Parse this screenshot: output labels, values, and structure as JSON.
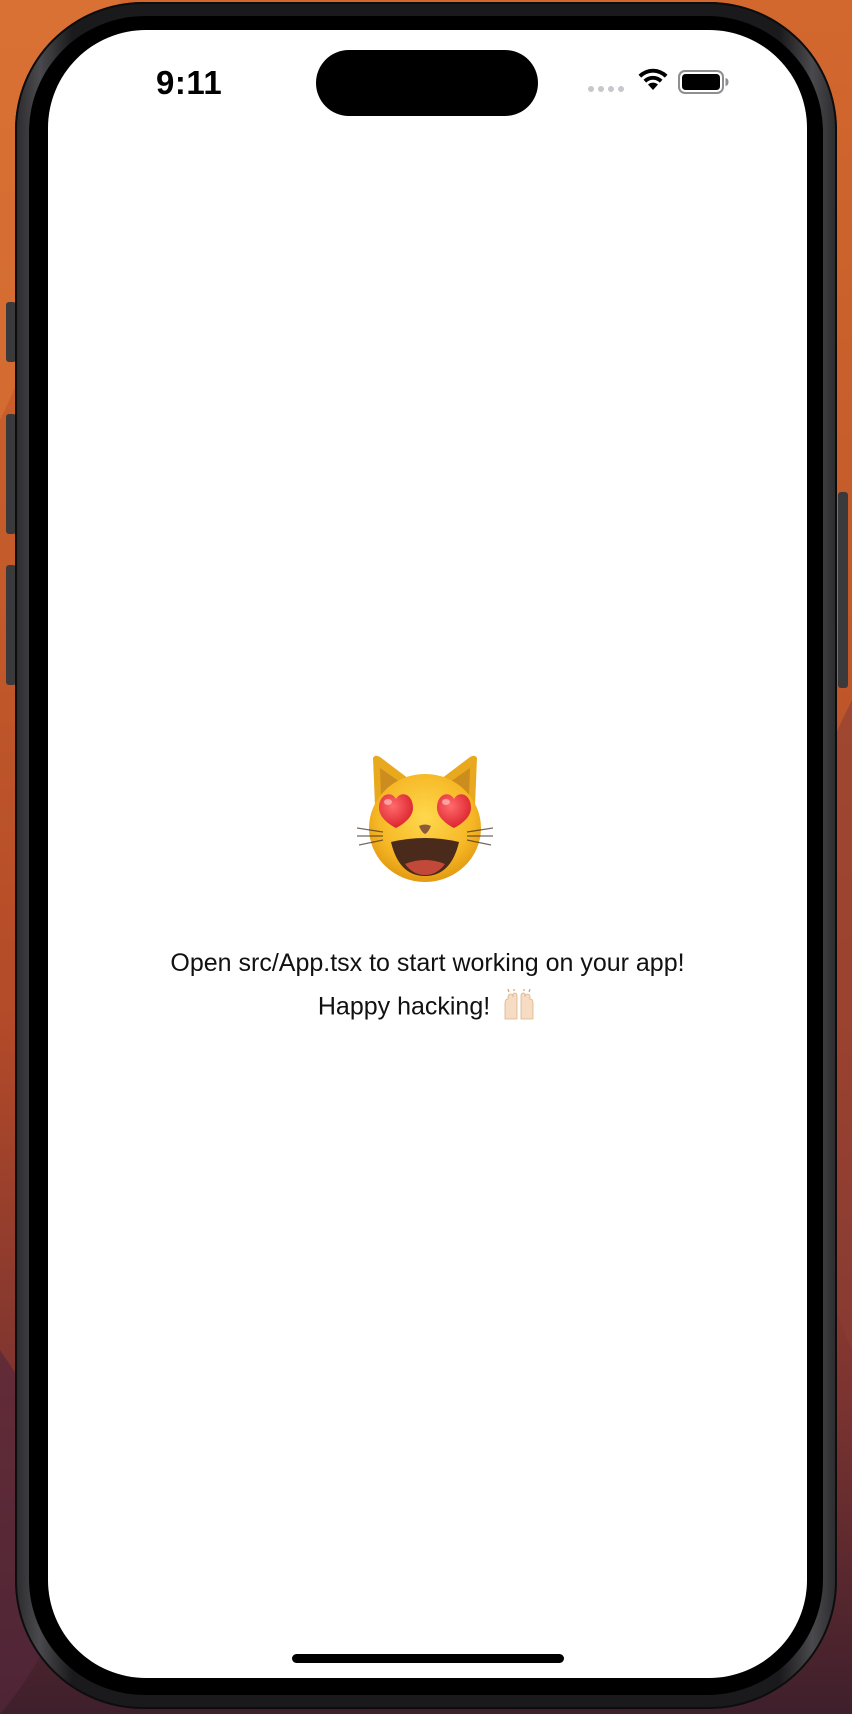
{
  "status_bar": {
    "time": "9:11"
  },
  "content": {
    "emoji_label": "smiling cat with heart-eyes",
    "message_line1": "Open src/App.tsx to start working on your app!",
    "message_line2": "Happy hacking!",
    "hands_emoji_label": "raising hands"
  },
  "colors": {
    "background_top": "#d3682e",
    "background_bottom": "#3e1f2c",
    "screen": "#ffffff",
    "text": "#111111"
  },
  "icons": [
    "cellular-signal-icon",
    "wifi-icon",
    "battery-icon",
    "cat-heart-eyes-emoji-icon",
    "raising-hands-emoji-icon"
  ]
}
